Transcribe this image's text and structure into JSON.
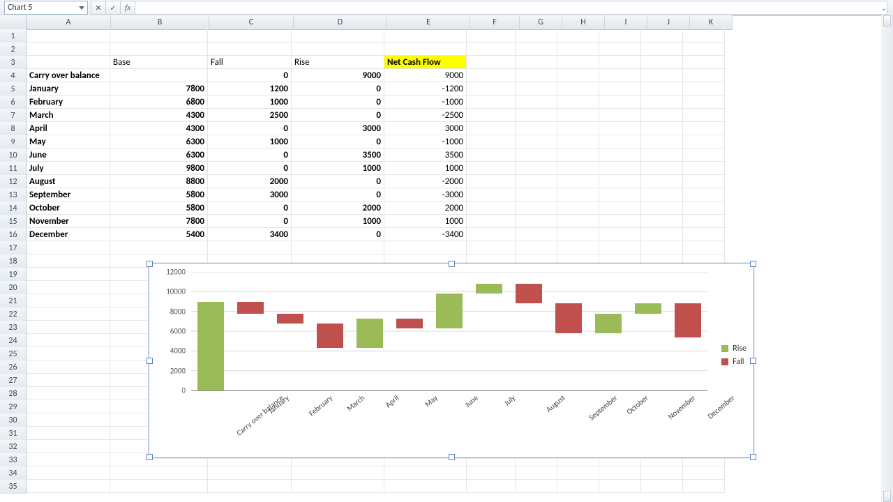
{
  "namebox": "Chart 5",
  "fx_label": "fx",
  "columns": [
    "A",
    "B",
    "C",
    "D",
    "E",
    "F",
    "G",
    "H",
    "I",
    "J",
    "K"
  ],
  "col_classes": [
    "cA",
    "cB",
    "cC",
    "cD",
    "cE",
    "cF",
    "cG",
    "cH",
    "cI",
    "cJ",
    "cK"
  ],
  "total_rows": 35,
  "headers": {
    "base": "Base",
    "fall": "Fall",
    "rise": "Rise",
    "net": "Net Cash Flow"
  },
  "table": [
    {
      "label": "Carry over balance",
      "base": "",
      "fall": "0",
      "rise": "9000",
      "net": "9000"
    },
    {
      "label": "January",
      "base": "7800",
      "fall": "1200",
      "rise": "0",
      "net": "-1200"
    },
    {
      "label": "February",
      "base": "6800",
      "fall": "1000",
      "rise": "0",
      "net": "-1000"
    },
    {
      "label": "March",
      "base": "4300",
      "fall": "2500",
      "rise": "0",
      "net": "-2500"
    },
    {
      "label": "April",
      "base": "4300",
      "fall": "0",
      "rise": "3000",
      "net": "3000"
    },
    {
      "label": "May",
      "base": "6300",
      "fall": "1000",
      "rise": "0",
      "net": "-1000"
    },
    {
      "label": "June",
      "base": "6300",
      "fall": "0",
      "rise": "3500",
      "net": "3500"
    },
    {
      "label": "July",
      "base": "9800",
      "fall": "0",
      "rise": "1000",
      "net": "1000"
    },
    {
      "label": "August",
      "base": "8800",
      "fall": "2000",
      "rise": "0",
      "net": "-2000"
    },
    {
      "label": "September",
      "base": "5800",
      "fall": "3000",
      "rise": "0",
      "net": "-3000"
    },
    {
      "label": "October",
      "base": "5800",
      "fall": "0",
      "rise": "2000",
      "net": "2000"
    },
    {
      "label": "November",
      "base": "7800",
      "fall": "0",
      "rise": "1000",
      "net": "1000"
    },
    {
      "label": "December",
      "base": "5400",
      "fall": "3400",
      "rise": "0",
      "net": "-3400"
    }
  ],
  "chart_data": {
    "type": "bar",
    "stacked": true,
    "categories": [
      "Carry over balance",
      "January",
      "February",
      "March",
      "April",
      "May",
      "June",
      "July",
      "August",
      "September",
      "October",
      "November",
      "December"
    ],
    "series": [
      {
        "name": "Base",
        "values": [
          0,
          7800,
          6800,
          4300,
          4300,
          6300,
          6300,
          9800,
          8800,
          5800,
          5800,
          7800,
          5400
        ],
        "color": "transparent"
      },
      {
        "name": "Fall",
        "values": [
          0,
          1200,
          1000,
          2500,
          0,
          1000,
          0,
          0,
          2000,
          3000,
          0,
          0,
          3400
        ],
        "color": "#c0504d"
      },
      {
        "name": "Rise",
        "values": [
          9000,
          0,
          0,
          0,
          3000,
          0,
          3500,
          1000,
          0,
          0,
          2000,
          1000,
          0
        ],
        "color": "#9bbb59"
      }
    ],
    "ylim": [
      0,
      12000
    ],
    "yticks": [
      0,
      2000,
      4000,
      6000,
      8000,
      10000,
      12000
    ],
    "legend": [
      "Rise",
      "Fall"
    ],
    "title": "",
    "xlabel": "",
    "ylabel": ""
  },
  "colors": {
    "rise": "#9bbb59",
    "fall": "#c0504d",
    "highlight": "#ffff00"
  }
}
